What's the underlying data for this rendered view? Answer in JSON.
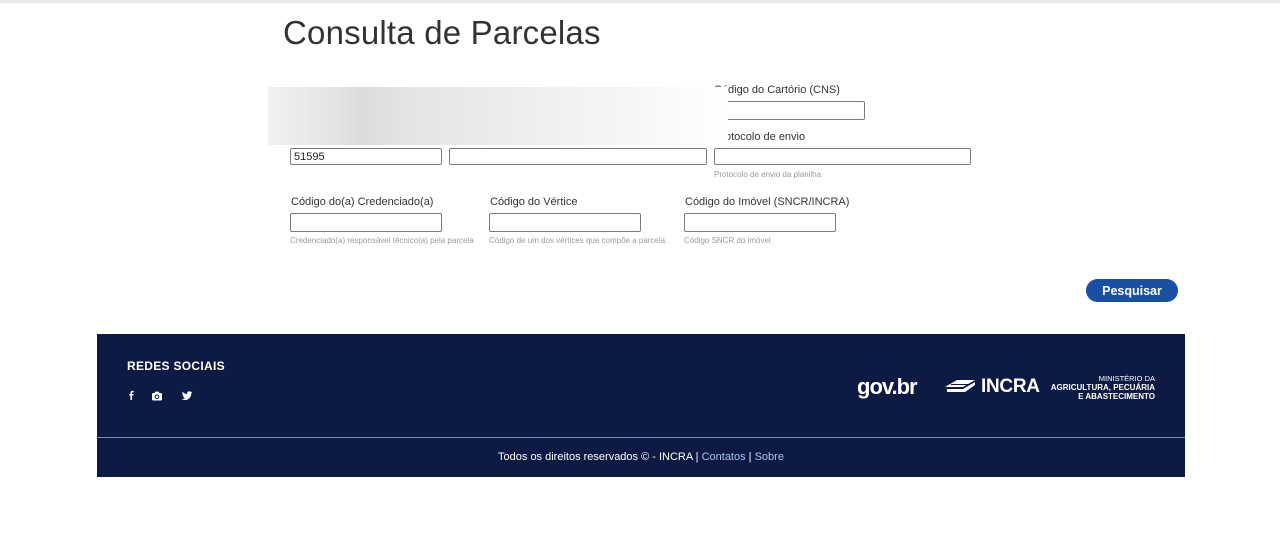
{
  "page": {
    "title": "Consulta de Parcelas"
  },
  "form": {
    "cartorio": {
      "label": "Código do Cartório (CNS)",
      "value": ""
    },
    "protocolo": {
      "label": "Protocolo de envio",
      "value": "",
      "help": "Protocolo de envio da planilha"
    },
    "codigo": {
      "value": "51595"
    },
    "segundo_campo": {
      "value": ""
    },
    "credenciado": {
      "label": "Código do(a) Credenciado(a)",
      "value": "",
      "help": "Credenciado(a) responsável técnico(a) pela parcela"
    },
    "vertice": {
      "label": "Código do Vértice",
      "value": "",
      "help": "Código de um dos vértices que compõe a parcela"
    },
    "imovel": {
      "label": "Código do Imóvel (SNCR/INCRA)",
      "value": "",
      "help": "Código SNCR do imóvel"
    },
    "search_button": "Pesquisar"
  },
  "footer": {
    "social_title": "REDES SOCIAIS",
    "social_icons": [
      "facebook-icon",
      "instagram-icon",
      "twitter-icon"
    ],
    "logos": {
      "govbr": "gov.br",
      "incra": "INCRA",
      "ministerio_line1": "MINISTÉRIO DA",
      "ministerio_line2": "AGRICULTURA, PECUÁRIA",
      "ministerio_line3": "E ABASTECIMENTO"
    },
    "copyright_text": "Todos os direitos reservados © - INCRA |",
    "link_contatos": "Contatos",
    "separator": "|",
    "link_sobre": "Sobre"
  },
  "colors": {
    "primary_button": "#1a4fa6",
    "footer_bg": "#0d1b44",
    "footer_link": "#a9c3f2"
  }
}
